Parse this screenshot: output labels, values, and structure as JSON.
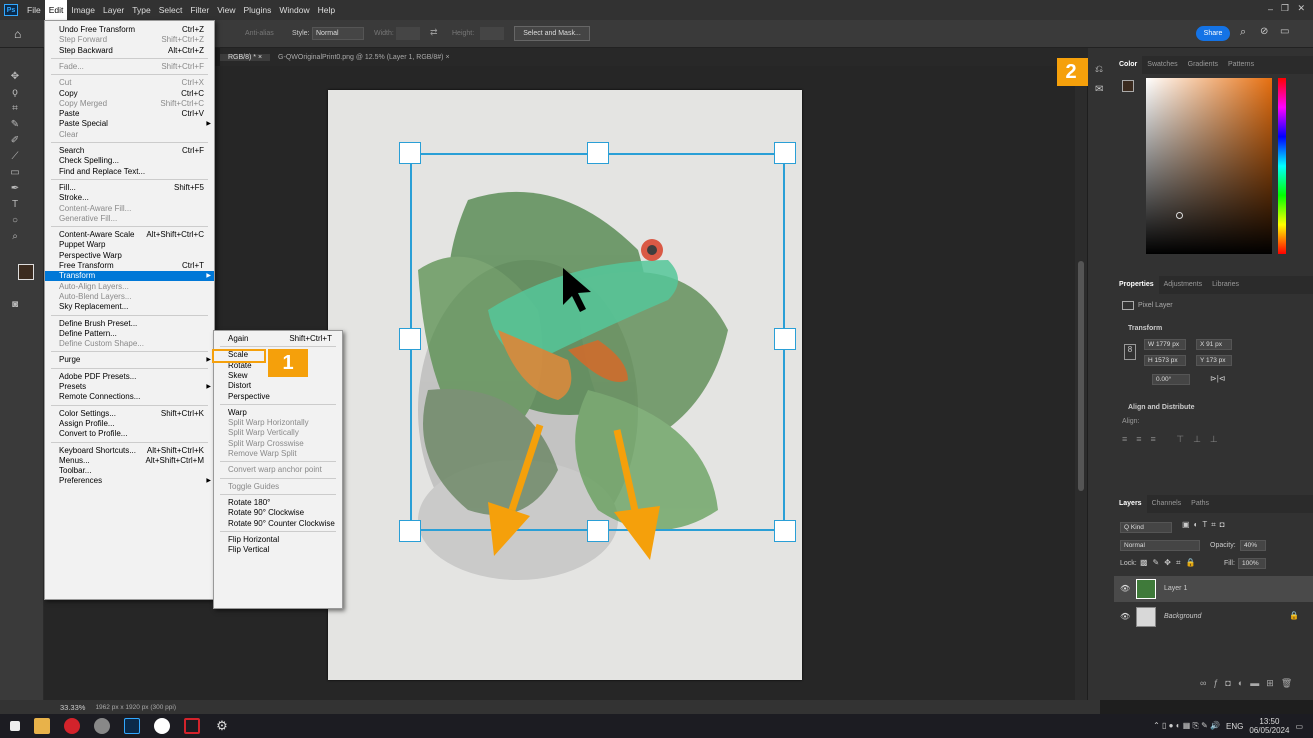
{
  "menubar": {
    "app_icon": "Ps",
    "items": [
      "File",
      "Edit",
      "Image",
      "Layer",
      "Type",
      "Select",
      "Filter",
      "View",
      "Plugins",
      "Window",
      "Help"
    ],
    "active": "Edit"
  },
  "optbar": {
    "antialias": "Anti-alias",
    "style_label": "Style:",
    "style_value": "Normal",
    "width_label": "Width:",
    "height_label": "Height:",
    "select_mask": "Select and Mask...",
    "share": "Share"
  },
  "tabs": [
    {
      "label": "RGB/8) *  ×"
    },
    {
      "label": "G-QWOriginalPrint0.png @ 12.5% (Layer 1, RGB/8#)  ×"
    }
  ],
  "edit_menu": [
    {
      "label": "Undo Free Transform",
      "shortcut": "Ctrl+Z",
      "disabled": false
    },
    {
      "label": "Step Forward",
      "shortcut": "Shift+Ctrl+Z",
      "disabled": true
    },
    {
      "label": "Step Backward",
      "shortcut": "Alt+Ctrl+Z",
      "disabled": false
    },
    {
      "sep": true
    },
    {
      "label": "Fade...",
      "shortcut": "Shift+Ctrl+F",
      "disabled": true
    },
    {
      "sep": true
    },
    {
      "label": "Cut",
      "shortcut": "Ctrl+X",
      "disabled": true
    },
    {
      "label": "Copy",
      "shortcut": "Ctrl+C",
      "disabled": false
    },
    {
      "label": "Copy Merged",
      "shortcut": "Shift+Ctrl+C",
      "disabled": true
    },
    {
      "label": "Paste",
      "shortcut": "Ctrl+V",
      "disabled": false
    },
    {
      "label": "Paste Special",
      "shortcut": "",
      "disabled": false,
      "sub": true
    },
    {
      "label": "Clear",
      "shortcut": "",
      "disabled": true
    },
    {
      "sep": true
    },
    {
      "label": "Search",
      "shortcut": "Ctrl+F",
      "disabled": false
    },
    {
      "label": "Check Spelling...",
      "shortcut": "",
      "disabled": false
    },
    {
      "label": "Find and Replace Text...",
      "shortcut": "",
      "disabled": false
    },
    {
      "sep": true
    },
    {
      "label": "Fill...",
      "shortcut": "Shift+F5",
      "disabled": false
    },
    {
      "label": "Stroke...",
      "shortcut": "",
      "disabled": false
    },
    {
      "label": "Content-Aware Fill...",
      "shortcut": "",
      "disabled": true
    },
    {
      "label": "Generative Fill...",
      "shortcut": "",
      "disabled": true
    },
    {
      "sep": true
    },
    {
      "label": "Content-Aware Scale",
      "shortcut": "Alt+Shift+Ctrl+C",
      "disabled": false
    },
    {
      "label": "Puppet Warp",
      "shortcut": "",
      "disabled": false
    },
    {
      "label": "Perspective Warp",
      "shortcut": "",
      "disabled": false
    },
    {
      "label": "Free Transform",
      "shortcut": "Ctrl+T",
      "disabled": false
    },
    {
      "label": "Transform",
      "shortcut": "",
      "disabled": false,
      "sub": true,
      "highlight": true
    },
    {
      "label": "Auto-Align Layers...",
      "shortcut": "",
      "disabled": true
    },
    {
      "label": "Auto-Blend Layers...",
      "shortcut": "",
      "disabled": true
    },
    {
      "label": "Sky Replacement...",
      "shortcut": "",
      "disabled": false
    },
    {
      "sep": true
    },
    {
      "label": "Define Brush Preset...",
      "shortcut": "",
      "disabled": false
    },
    {
      "label": "Define Pattern...",
      "shortcut": "",
      "disabled": false
    },
    {
      "label": "Define Custom Shape...",
      "shortcut": "",
      "disabled": true
    },
    {
      "sep": true
    },
    {
      "label": "Purge",
      "shortcut": "",
      "disabled": false,
      "sub": true
    },
    {
      "sep": true
    },
    {
      "label": "Adobe PDF Presets...",
      "shortcut": "",
      "disabled": false
    },
    {
      "label": "Presets",
      "shortcut": "",
      "disabled": false,
      "sub": true
    },
    {
      "label": "Remote Connections...",
      "shortcut": "",
      "disabled": false
    },
    {
      "sep": true
    },
    {
      "label": "Color Settings...",
      "shortcut": "Shift+Ctrl+K",
      "disabled": false
    },
    {
      "label": "Assign Profile...",
      "shortcut": "",
      "disabled": false
    },
    {
      "label": "Convert to Profile...",
      "shortcut": "",
      "disabled": false
    },
    {
      "sep": true
    },
    {
      "label": "Keyboard Shortcuts...",
      "shortcut": "Alt+Shift+Ctrl+K",
      "disabled": false
    },
    {
      "label": "Menus...",
      "shortcut": "Alt+Shift+Ctrl+M",
      "disabled": false
    },
    {
      "label": "Toolbar...",
      "shortcut": "",
      "disabled": false
    },
    {
      "label": "Preferences",
      "shortcut": "",
      "disabled": false,
      "sub": true
    }
  ],
  "transform_menu": [
    {
      "label": "Again",
      "shortcut": "Shift+Ctrl+T",
      "disabled": false
    },
    {
      "sep": true
    },
    {
      "label": "Scale",
      "shortcut": "",
      "disabled": false,
      "boxed": true
    },
    {
      "label": "Rotate",
      "shortcut": "",
      "disabled": false
    },
    {
      "label": "Skew",
      "shortcut": "",
      "disabled": false
    },
    {
      "label": "Distort",
      "shortcut": "",
      "disabled": false
    },
    {
      "label": "Perspective",
      "shortcut": "",
      "disabled": false
    },
    {
      "sep": true
    },
    {
      "label": "Warp",
      "shortcut": "",
      "disabled": false
    },
    {
      "label": "Split Warp Horizontally",
      "shortcut": "",
      "disabled": true
    },
    {
      "label": "Split Warp Vertically",
      "shortcut": "",
      "disabled": true
    },
    {
      "label": "Split Warp Crosswise",
      "shortcut": "",
      "disabled": true
    },
    {
      "label": "Remove Warp Split",
      "shortcut": "",
      "disabled": true
    },
    {
      "sep": true
    },
    {
      "label": "Convert warp anchor point",
      "shortcut": "",
      "disabled": true
    },
    {
      "sep": true
    },
    {
      "label": "Toggle Guides",
      "shortcut": "",
      "disabled": true
    },
    {
      "sep": true
    },
    {
      "label": "Rotate 180°",
      "shortcut": "",
      "disabled": false
    },
    {
      "label": "Rotate 90° Clockwise",
      "shortcut": "",
      "disabled": false
    },
    {
      "label": "Rotate 90° Counter Clockwise",
      "shortcut": "",
      "disabled": false
    },
    {
      "sep": true
    },
    {
      "label": "Flip Horizontal",
      "shortcut": "",
      "disabled": false
    },
    {
      "label": "Flip Vertical",
      "shortcut": "",
      "disabled": false
    }
  ],
  "badges": {
    "one": "1",
    "two": "2"
  },
  "panels": {
    "color_tabs": [
      "Color",
      "Swatches",
      "Gradients",
      "Patterns"
    ],
    "prop_tabs": [
      "Properties",
      "Adjustments",
      "Libraries"
    ],
    "pixel_layer": "Pixel Layer",
    "transform_title": "Transform",
    "w": "W  1779 px",
    "x": "X  91 px",
    "h": "H  1573 px",
    "y": "Y  173 px",
    "angle": "0.00°",
    "align_title": "Align and Distribute",
    "align_label": "Align:",
    "layer_tabs": [
      "Layers",
      "Channels",
      "Paths"
    ],
    "kind": "Q Kind",
    "blend": "Normal",
    "opacity_label": "Opacity:",
    "opacity": "40%",
    "lock_label": "Lock:",
    "fill_label": "Fill:",
    "fill": "100%",
    "layers": [
      {
        "name": "Layer 1"
      },
      {
        "name": "Background"
      }
    ]
  },
  "status": {
    "zoom": "33.33%",
    "info": "1962 px x 1920 px (300 ppi)"
  },
  "tray": {
    "lang": "ENG",
    "time": "13:50",
    "date": "06/05/2024"
  },
  "colors": {
    "accent": "#f5a00b",
    "bbox": "#2a9fd6",
    "highlight": "#0078d7"
  }
}
